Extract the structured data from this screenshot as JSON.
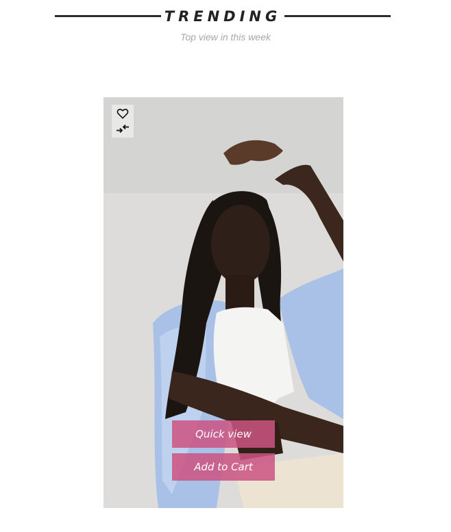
{
  "section": {
    "title": "TRENDING",
    "subtitle": "Top view in this week"
  },
  "product": {
    "image_subject": "woman in white tank top and light blue shirt",
    "actions": {
      "wishlist_icon": "heart-icon",
      "compare_icon": "compare-arrows-icon"
    },
    "quick_view_label": "Quick view",
    "add_to_cart_label": "Add to Cart"
  },
  "colors": {
    "accent": "#cc5481",
    "title": "#222222",
    "subtitle": "#a7a7a7"
  }
}
